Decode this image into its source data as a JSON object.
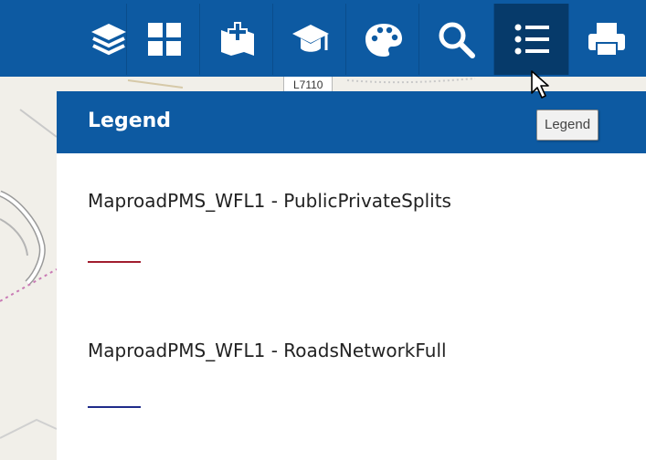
{
  "toolbar": {
    "buttons": [
      {
        "icon": "layers-icon"
      },
      {
        "icon": "grid-icon"
      },
      {
        "icon": "add-data-icon"
      },
      {
        "icon": "graduation-cap-icon"
      },
      {
        "icon": "palette-icon"
      },
      {
        "icon": "search-icon"
      },
      {
        "icon": "legend-list-icon",
        "active": true
      },
      {
        "icon": "printer-icon"
      }
    ],
    "colors": {
      "bar": "#0d5aa2",
      "active": "#063a6a"
    }
  },
  "map": {
    "road_label": "L7110"
  },
  "tooltip": {
    "text": "Legend"
  },
  "legend": {
    "title": "Legend",
    "layers": [
      {
        "name": "MaproadPMS_WFL1 - PublicPrivateSplits",
        "color": "#a11d2e"
      },
      {
        "name": "MaproadPMS_WFL1 - RoadsNetworkFull",
        "color": "#1f2c8a"
      }
    ]
  }
}
